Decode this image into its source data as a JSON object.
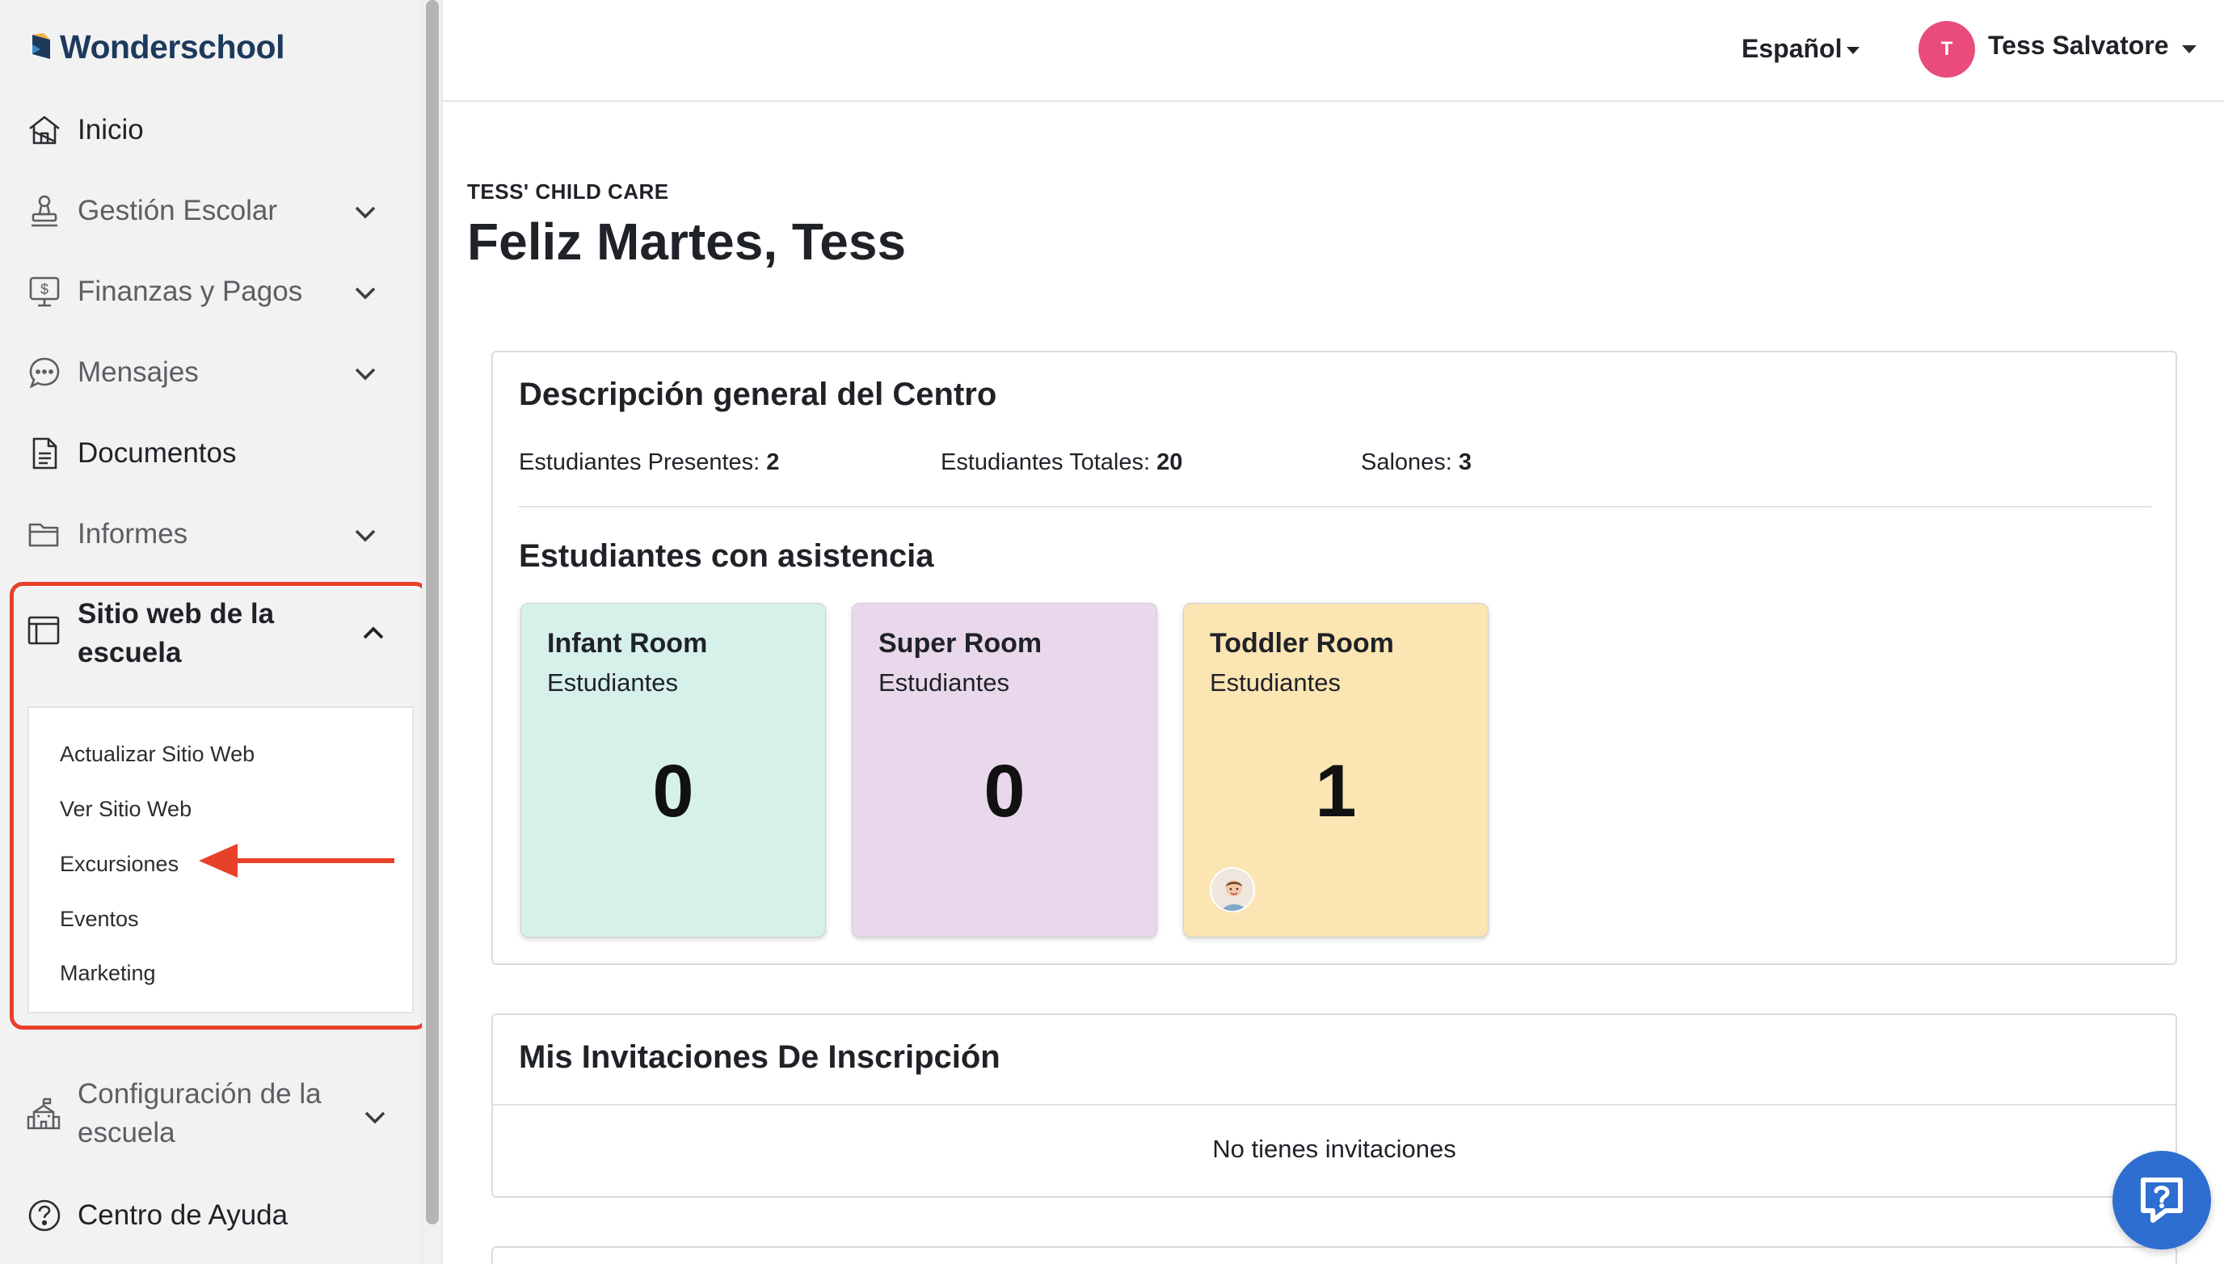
{
  "app": {
    "brand": "Wonderschool"
  },
  "sidebar": {
    "items": [
      {
        "label": "Inicio",
        "icon": "home-icon"
      },
      {
        "label": "Gestión Escolar",
        "icon": "stamp-icon"
      },
      {
        "label": "Finanzas y Pagos",
        "icon": "dollar-monitor-icon"
      },
      {
        "label": "Mensajes",
        "icon": "chat-icon"
      },
      {
        "label": "Documentos",
        "icon": "document-icon"
      },
      {
        "label": "Informes",
        "icon": "folder-icon"
      }
    ],
    "website_section": {
      "label_line1": "Sitio web de la",
      "label_line2": "escuela",
      "icon": "browser-window-icon",
      "subitems": [
        "Actualizar Sitio Web",
        "Ver Sitio Web",
        "Excursiones",
        "Eventos",
        "Marketing"
      ]
    },
    "config": {
      "label_line1": "Configuración de la",
      "label_line2": "escuela",
      "icon": "school-building-icon"
    },
    "help": {
      "label": "Centro de Ayuda",
      "icon": "question-circle-icon"
    }
  },
  "topbar": {
    "language": "Español",
    "avatar_initial": "T",
    "user_name": "Tess Salvatore",
    "avatar_color": "#e94b7a"
  },
  "main": {
    "school_name": "TESS' CHILD CARE",
    "greeting": "Feliz Martes, Tess",
    "overview": {
      "title": "Descripción general del Centro",
      "stats": [
        {
          "label": "Estudiantes Presentes:",
          "value": "2"
        },
        {
          "label": "Estudiantes Totales:",
          "value": "20"
        },
        {
          "label": "Salones:",
          "value": "3"
        }
      ],
      "attendance_title": "Estudiantes con asistencia",
      "rooms": [
        {
          "name": "Infant Room",
          "sub": "Estudiantes",
          "count": "0",
          "color": "#d6f0ea"
        },
        {
          "name": "Super Room",
          "sub": "Estudiantes",
          "count": "0",
          "color": "#e9d7eb"
        },
        {
          "name": "Toddler Room",
          "sub": "Estudiantes",
          "count": "1",
          "color": "#fbe5b3"
        }
      ]
    },
    "invites": {
      "title": "Mis Invitaciones De Inscripción",
      "empty": "No tienes invitaciones"
    }
  },
  "colors": {
    "highlight": "#e8412a",
    "help_button": "#2f6ed1",
    "brand_text": "#1d3a5c"
  }
}
